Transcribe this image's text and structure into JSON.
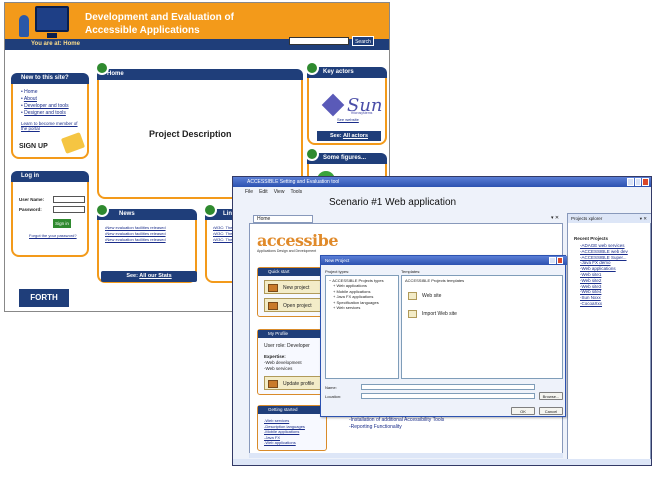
{
  "portal": {
    "title_line1": "Development and Evaluation of",
    "title_line2": "Accessible Applications",
    "you_are_at": "You are at: Home",
    "search_button": "Search",
    "new_to_site": {
      "title": "New to this site?",
      "items": [
        "Home",
        "About",
        "Developer and tools",
        "Designer and tools"
      ],
      "learn_member": "Learn to become member of the portal",
      "signup": "SIGN UP"
    },
    "login": {
      "title": "Log in",
      "user_label": "User Name:",
      "password_label": "Password:",
      "signin": "Sign in",
      "forgot": "Forgot the your password?"
    },
    "home": {
      "title": "Home",
      "description": "Project Description"
    },
    "news": {
      "title": "News",
      "items": [
        "New evaluation facilities released",
        "New evaluation facilities released",
        "New evaluation facilities released"
      ],
      "stats_prefix": "See: ",
      "stats_link": "All our Stats"
    },
    "links": {
      "title": "Links",
      "items": [
        "W3C: The Wo...",
        "W3C: The Wo...",
        "W3C: The Wo..."
      ]
    },
    "key_actors": {
      "title": "Key actors",
      "sun_name": "Sun",
      "sun_sub": "microsystems",
      "see_website": "See website",
      "see_prefix": "See: ",
      "see_link": "All actors"
    },
    "figures": {
      "title": "Some figures..."
    },
    "forth": "FORTH"
  },
  "ide": {
    "title": "ACCESSIBLE Setting and Evaluation tool",
    "menu": [
      "File",
      "Edit",
      "View",
      "Tools"
    ],
    "scenario": "Scenario #1 Web application",
    "doc_tab": "Home",
    "logo_text": "accessibe",
    "logo_sub": "Applications Design and Development",
    "quick_start": {
      "title": "Quick start",
      "new_project": "New project",
      "open_project": "Open project"
    },
    "my_profile": {
      "title": "My Profile",
      "role": "User role: Developer",
      "expertise_label": "Expertise:",
      "expertise": [
        "-Web development",
        "-Web services"
      ],
      "update": "Update profile"
    },
    "getting_started": {
      "title": "Getting started",
      "items": [
        "-Web services",
        "-Description languages",
        "-Mobile applications",
        "-Java FX",
        "-Web applications"
      ]
    },
    "recent_items": [
      "-Installation of additional Accessibility Tools",
      "-Reporting Functionality"
    ],
    "projects_pane": {
      "title": "Projects xplorer",
      "recent_label": "Recent Projects",
      "items": [
        "-ADAGE web services",
        "-ACCESSIBLE web dev",
        "-ACCESSIBLE Super...",
        "-Java FX demo",
        "-Web applications",
        "-Web site1",
        "-Web site2",
        "-Web site3",
        "-Web site4",
        "-Sun Nxxx",
        "-CocoaXxx"
      ]
    }
  },
  "dialog": {
    "title": "New Project",
    "project_types_label": "Project types:",
    "templates_label": "Templates:",
    "project_types": [
      "ACCESSIBLE Projects types",
      "Web applications",
      "Mobile applications",
      "Java FX applications",
      "Specification languages",
      "Web services"
    ],
    "templates_header": "ACCESSIBLE Projects templates",
    "templates": [
      "Web site",
      "Import Web site"
    ],
    "name_label": "Name:",
    "location_label": "Location:",
    "browse": "Browse...",
    "ok": "OK",
    "cancel": "Cancel"
  },
  "colors": {
    "accent_orange": "#f39a1a",
    "navy": "#1f3e7a",
    "link_blue": "#1a2d8a",
    "titlebar_blue": "#2c52b0"
  }
}
